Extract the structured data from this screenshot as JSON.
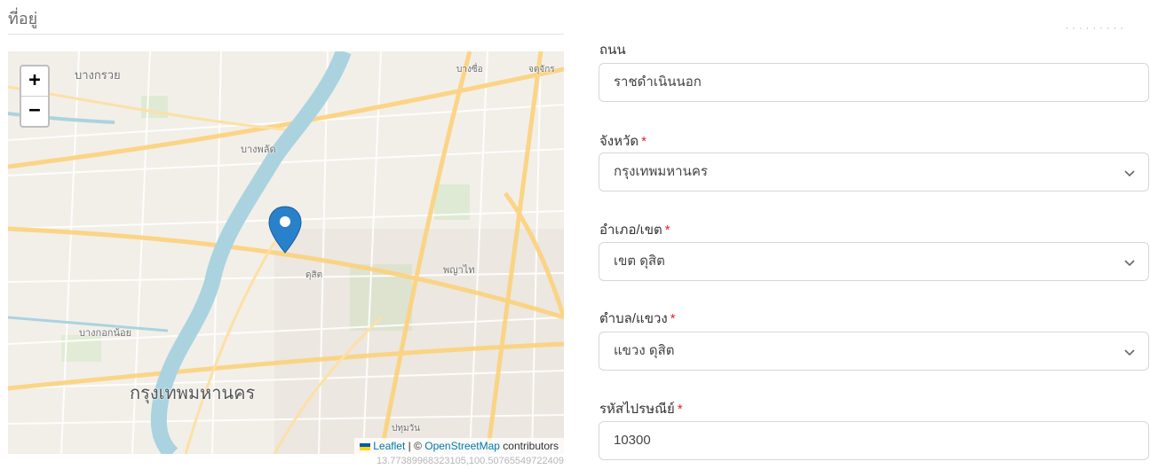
{
  "section": {
    "title": "ที่อยู่"
  },
  "map": {
    "zoom_in": "+",
    "zoom_out": "−",
    "labels": {
      "bang_kruai": "บางกรวย",
      "bang_sue": "บางซื่อ",
      "chatuchak": "จตุจักร",
      "bang_phlat": "บางพลัด",
      "dusit": "ดุสิต",
      "phaya_thai": "พญาไท",
      "bangkok_noi": "บางกอกน้อย",
      "bangkok": "กรุงเทพมหานคร",
      "pathum_wan": "ปทุมวัน"
    },
    "attribution": {
      "leaflet": "Leaflet",
      "sep": " | © ",
      "osm": "OpenStreetMap",
      "contributors": " contributors"
    },
    "coordinates": "13.77389968323105,100.50765549722409"
  },
  "form": {
    "road": {
      "label": "ถนน",
      "value": "ราชดำเนินนอก"
    },
    "province": {
      "label": "จังหวัด",
      "required": "*",
      "value": "กรุงเทพมหานคร"
    },
    "district": {
      "label": "อำเภอ/เขต",
      "required": "*",
      "value": "เขต ดุสิต"
    },
    "subdistrict": {
      "label": "ตำบล/แขวง",
      "required": "*",
      "value": "แขวง ดุสิต"
    },
    "postcode": {
      "label": "รหัสไปรษณีย์",
      "required": "*",
      "value": "10300"
    }
  },
  "colors": {
    "marker": "#2a81cb",
    "required": "#e02424",
    "link": "#0078a8",
    "river": "#aad3df",
    "major_road": "#fcd27c"
  },
  "icons": [
    "map-marker-icon",
    "chevron-down-icon",
    "ukraine-flag-icon"
  ]
}
